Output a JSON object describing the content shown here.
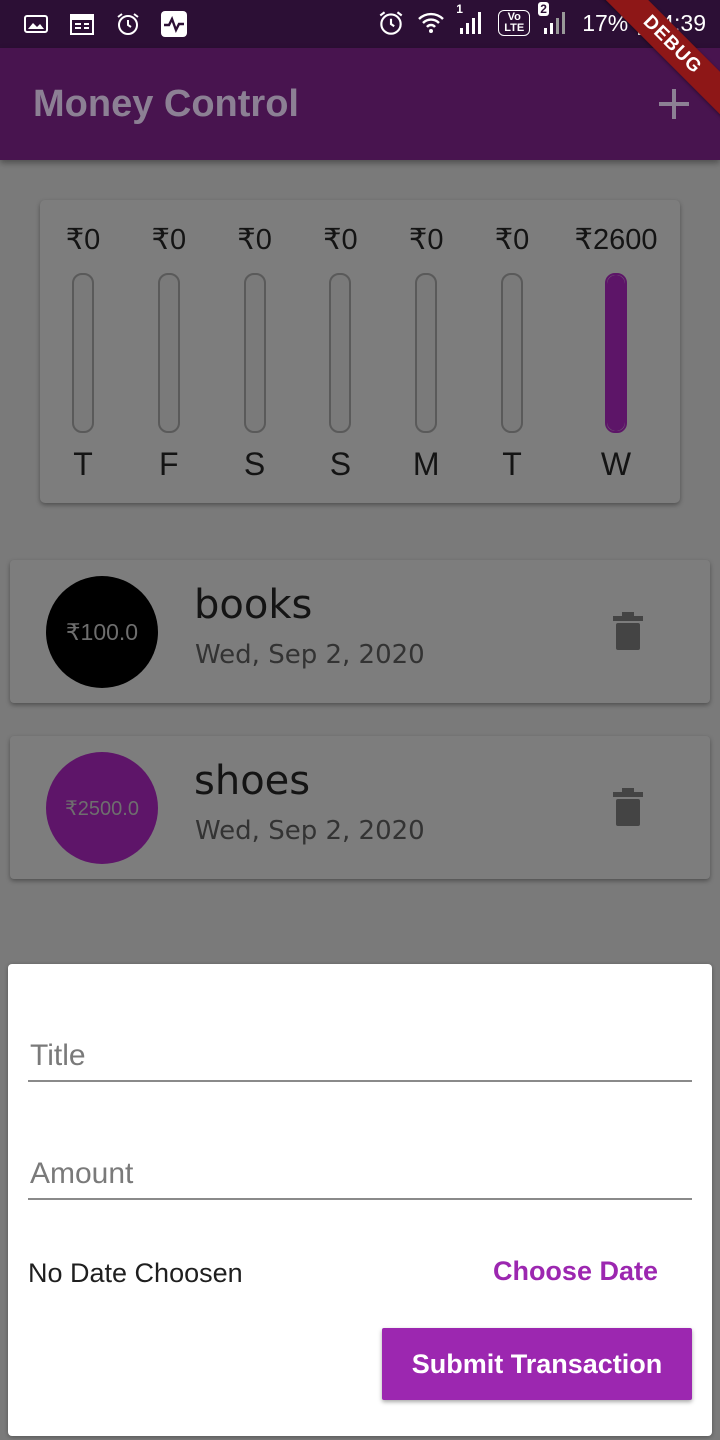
{
  "status_bar": {
    "battery": "17%",
    "time": "4:39",
    "sim1_label": "1",
    "sim2_label": "2",
    "volte_label": "Vo LTE"
  },
  "debug_banner": "DEBUG",
  "app_bar": {
    "title": "Money Control",
    "add_icon": "plus-icon"
  },
  "chart": {
    "days": [
      {
        "day": "T",
        "amount": "₹0",
        "pct": 0
      },
      {
        "day": "F",
        "amount": "₹0",
        "pct": 0
      },
      {
        "day": "S",
        "amount": "₹0",
        "pct": 0
      },
      {
        "day": "S",
        "amount": "₹0",
        "pct": 0
      },
      {
        "day": "M",
        "amount": "₹0",
        "pct": 0
      },
      {
        "day": "T",
        "amount": "₹0",
        "pct": 0
      },
      {
        "day": "W",
        "amount": "₹2600",
        "pct": 1
      }
    ],
    "fill_color": "#5d1568"
  },
  "transactions": [
    {
      "amount": "₹100.0",
      "title": "books",
      "date": "Wed, Sep 2, 2020",
      "avatar_color": "#000000"
    },
    {
      "amount": "₹2500.0",
      "title": "shoes",
      "date": "Wed, Sep 2, 2020",
      "avatar_color": "#5e1569"
    }
  ],
  "form": {
    "title_placeholder": "Title",
    "amount_placeholder": "Amount",
    "date_status": "No Date Choosen",
    "choose_date_label": "Choose Date",
    "submit_label": "Submit Transaction",
    "accent_color": "#9c27b0"
  }
}
